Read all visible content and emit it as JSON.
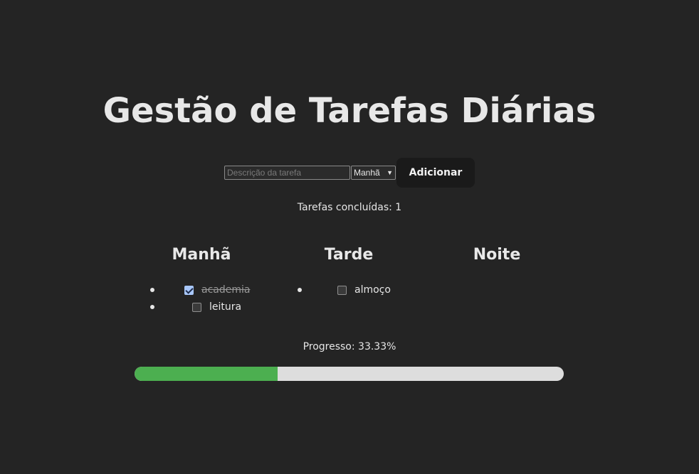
{
  "title": "Gestão de Tarefas Diárias",
  "form": {
    "input_value": "",
    "input_placeholder": "Descrição da tarefa",
    "period_selected": "Manhã",
    "add_label": "Adicionar"
  },
  "done_count_text": "Tarefas concluídas: 1",
  "columns": [
    {
      "title": "Manhã",
      "tasks": [
        {
          "label": "academia",
          "done": true
        },
        {
          "label": "leitura",
          "done": false
        }
      ]
    },
    {
      "title": "Tarde",
      "tasks": [
        {
          "label": "almoço",
          "done": false
        }
      ]
    },
    {
      "title": "Noite",
      "tasks": []
    }
  ],
  "progress": {
    "text": "Progresso: 33.33%",
    "percent": 33.33
  },
  "colors": {
    "background": "#242424",
    "progress_fill": "#4caf50",
    "progress_track": "#dddddd",
    "checkbox_checked": "#a8c7fa"
  }
}
